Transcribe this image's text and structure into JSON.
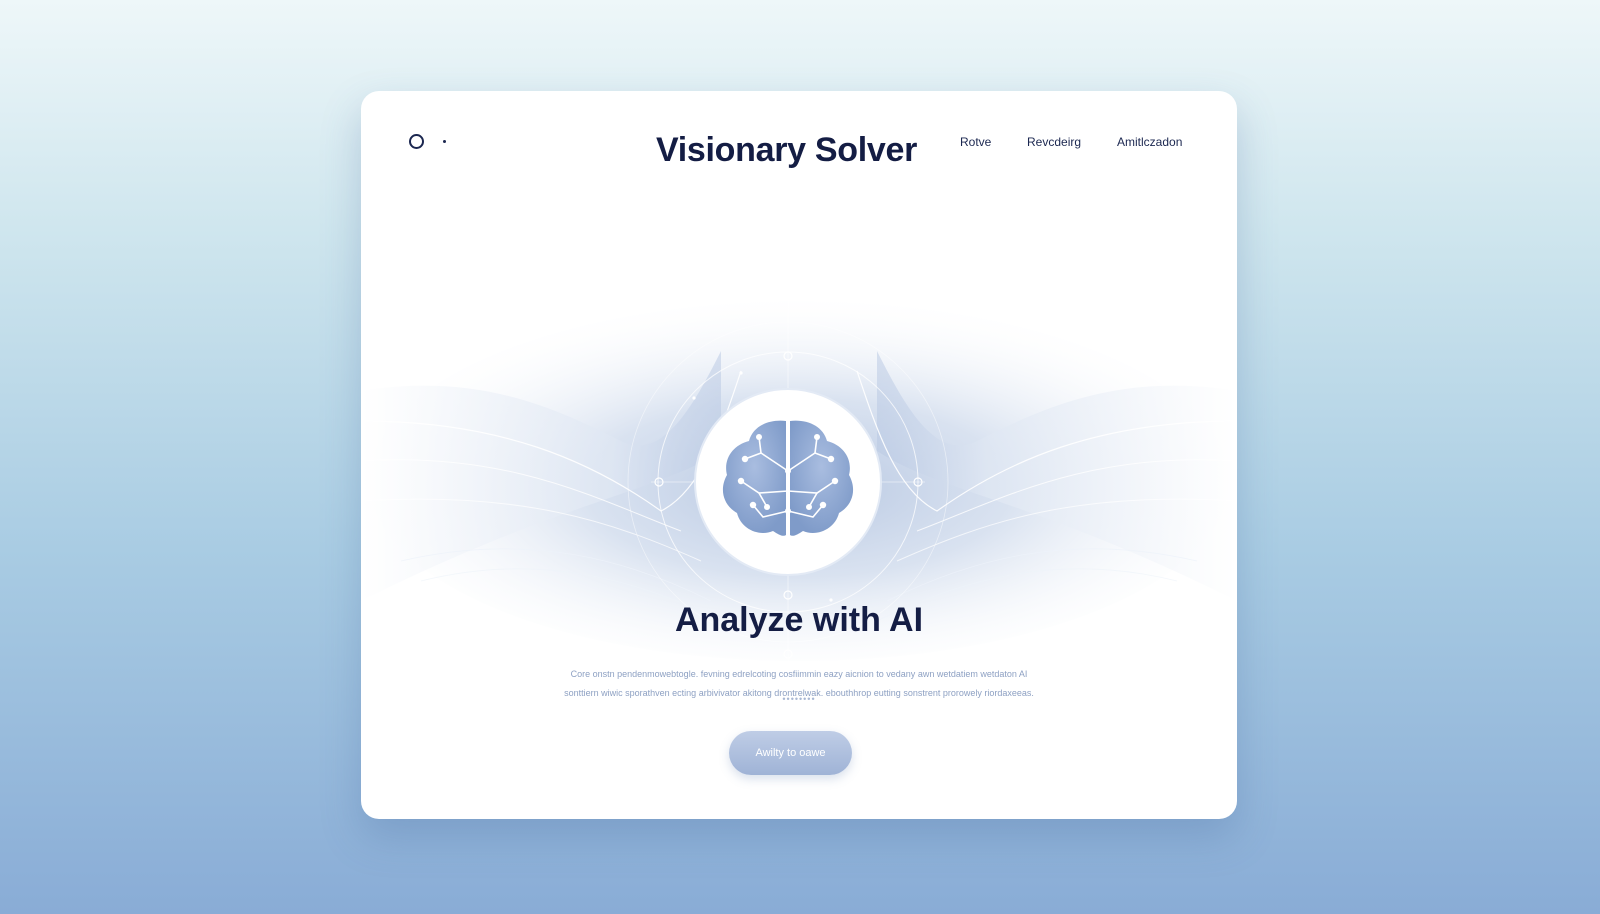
{
  "header": {
    "title": "Visionary Solver",
    "nav": [
      "Rotve",
      "Revcdeirg",
      "Amitlczadon"
    ]
  },
  "hero": {
    "illustration_icon": "brain-circuit-icon"
  },
  "main": {
    "headline": "Analyze with AI",
    "body_line_1": "Core onstn pendenmowebtogle. fevning edrelcoting cosfiimmin eazy aicnion to vedany awn wetdatiem wetdaton AI",
    "body_line_2": "sonttiern wiwic sporathven ecting arbivivator akitong drontrelwak. ebouthhrop eutting sonstrent prorowely riordaxeeas.",
    "dots": "••••••••",
    "cta_label": "Awilty to oawe"
  },
  "colors": {
    "accent": "#9fb3d6",
    "title": "#141d44",
    "body_text": "#8ea1c3"
  }
}
